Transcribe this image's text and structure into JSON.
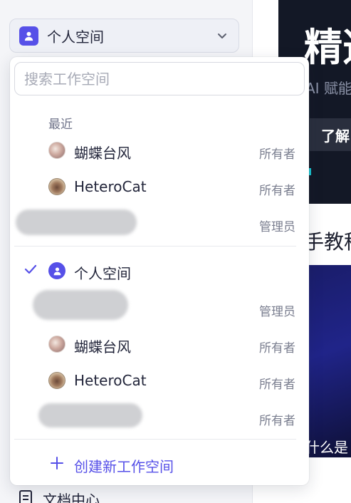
{
  "sidebar": {
    "workspace_label": "个人空间",
    "doc_center_label": "文档中心"
  },
  "content": {
    "hero_title": "精选",
    "hero_sub": "AI 赋能",
    "hero_button": "了解",
    "tutorial_title": "手教程",
    "video_caption": "什么是"
  },
  "dropdown": {
    "search_placeholder": "搜索工作空间",
    "recent_title": "最近",
    "recent": [
      {
        "name": "蝴蝶台风",
        "role": "所有者",
        "avatar": "butterfly-avatar"
      },
      {
        "name": "HeteroCat",
        "role": "所有者",
        "avatar": "cat-avatar"
      },
      {
        "name": "",
        "role": "管理员",
        "avatar": "redacted"
      }
    ],
    "all": [
      {
        "name": "个人空间",
        "role": "",
        "avatar": "person-icon",
        "selected": true
      },
      {
        "name": "",
        "role": "管理员",
        "avatar": "redacted"
      },
      {
        "name": "蝴蝶台风",
        "role": "所有者",
        "avatar": "butterfly-avatar"
      },
      {
        "name": "HeteroCat",
        "role": "所有者",
        "avatar": "cat-avatar"
      },
      {
        "name": "",
        "role": "所有者",
        "avatar": "redacted"
      }
    ],
    "create_label": "创建新工作空间"
  },
  "colors": {
    "accent": "#5650e8",
    "muted_text": "#7a7e8f",
    "hero_bg": "#131826"
  }
}
